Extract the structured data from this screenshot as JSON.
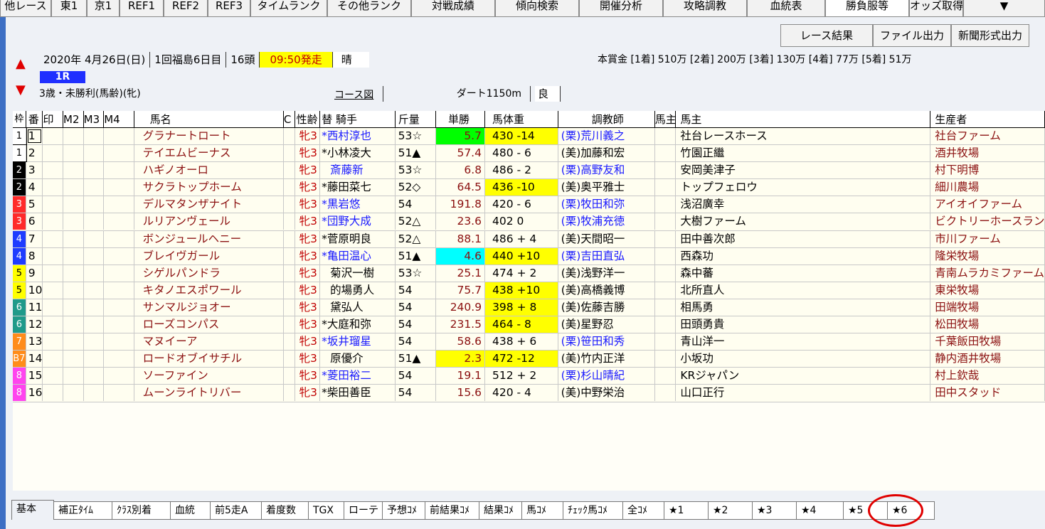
{
  "toolbar": {
    "top": [
      "他レース",
      "東1",
      "京1",
      "REF1",
      "REF2",
      "REF3",
      "タイムランク",
      "その他ランク",
      "対戦成績",
      "傾向検索",
      "開催分析",
      "攻略調教",
      "血統表",
      "勝負服等",
      "オッズ取得"
    ],
    "second": [
      "レース結果",
      "ファイル出力",
      "新聞形式出力"
    ]
  },
  "race": {
    "date": "2020年 4月26日(日)",
    "meeting": "1回福島6日目",
    "runners": "16頭",
    "start_time": "09:50発走",
    "weather": "晴",
    "race_no": "1R",
    "condition": "3歳・未勝利(馬齢)(牝)",
    "course_link": "コース図",
    "course": "ダート1150m",
    "track": "良",
    "prize": "本賞金 [1着] 510万 [2着] 200万 [3着] 130万 [4着] 77万 [5着] 51万"
  },
  "headers": {
    "waku": "枠",
    "ban": "番",
    "in": "印",
    "m2": "M2",
    "m3": "M3",
    "m4": "M4",
    "name": "馬名",
    "c": "C",
    "sex": "性齢",
    "jockey": "替 騎手",
    "kin": "斤量",
    "odds": "単勝",
    "bw": "馬体重",
    "trainer": "調教師",
    "uma": "馬主",
    "owner": "馬主",
    "breeder": "生産者"
  },
  "horses": [
    {
      "waku": "1",
      "ban": "1",
      "name": "グラナートロート",
      "sex": "牝3",
      "jockey": "*西村淳也",
      "kin": "53☆",
      "odds": "5.7",
      "bw": "430 -14",
      "trainer": "(栗)荒川義之",
      "owner": "社台レースホース",
      "breeder": "社台ファーム"
    },
    {
      "waku": "1",
      "ban": "2",
      "name": "テイエムビーナス",
      "sex": "牝3",
      "jockey": "*小林凌大",
      "kin": "51▲",
      "odds": "57.4",
      "bw": "480 - 6",
      "trainer": "(美)加藤和宏",
      "owner": "竹園正繼",
      "breeder": "酒井牧場"
    },
    {
      "waku": "2",
      "ban": "3",
      "name": "ハギノオーロ",
      "sex": "牝3",
      "jockey": "斎藤新",
      "kin": "53☆",
      "odds": "6.8",
      "bw": "486 - 2",
      "trainer": "(栗)高野友和",
      "owner": "安岡美津子",
      "breeder": "村下明博"
    },
    {
      "waku": "2",
      "ban": "4",
      "name": "サクラトップホーム",
      "sex": "牝3",
      "jockey": "*藤田菜七",
      "kin": "52◇",
      "odds": "64.5",
      "bw": "436 -10",
      "trainer": "(美)奥平雅士",
      "owner": "トップフェロウ",
      "breeder": "細川農場"
    },
    {
      "waku": "3",
      "ban": "5",
      "name": "デルマタンザナイト",
      "sex": "牝3",
      "jockey": "*黒岩悠",
      "kin": "54",
      "odds": "191.8",
      "bw": "420 - 6",
      "trainer": "(栗)牧田和弥",
      "owner": "浅沼廣幸",
      "breeder": "アイオイファーム"
    },
    {
      "waku": "3",
      "ban": "6",
      "name": "ルリアンヴェール",
      "sex": "牝3",
      "jockey": "*団野大成",
      "kin": "52△",
      "odds": "23.6",
      "bw": "402   0",
      "trainer": "(栗)牧浦充徳",
      "owner": "大樹ファーム",
      "breeder": "ビクトリーホースランチ"
    },
    {
      "waku": "4",
      "ban": "7",
      "name": "ボンジュールヘニー",
      "sex": "牝3",
      "jockey": "*菅原明良",
      "kin": "52△",
      "odds": "88.1",
      "bw": "486 + 4",
      "trainer": "(美)天間昭一",
      "owner": "田中善次郎",
      "breeder": "市川ファーム"
    },
    {
      "waku": "4",
      "ban": "8",
      "name": "ブレイヴガール",
      "sex": "牝3",
      "jockey": "*亀田温心",
      "kin": "51▲",
      "odds": "4.6",
      "bw": "440 +10",
      "trainer": "(栗)吉田直弘",
      "owner": "西森功",
      "breeder": "隆栄牧場"
    },
    {
      "waku": "5",
      "ban": "9",
      "name": "シゲルパンドラ",
      "sex": "牝3",
      "jockey": "菊沢一樹",
      "kin": "53☆",
      "odds": "25.1",
      "bw": "474 + 2",
      "trainer": "(美)浅野洋一",
      "owner": "森中蕃",
      "breeder": "青南ムラカミファーム"
    },
    {
      "waku": "5",
      "ban": "10",
      "name": "キタノエスポワール",
      "sex": "牝3",
      "jockey": "的場勇人",
      "kin": "54",
      "odds": "75.7",
      "bw": "438 +10",
      "trainer": "(美)高橋義博",
      "owner": "北所直人",
      "breeder": "東栄牧場"
    },
    {
      "waku": "6",
      "ban": "11",
      "name": "サンマルジョオー",
      "sex": "牝3",
      "jockey": "黛弘人",
      "kin": "54",
      "odds": "240.9",
      "bw": "398 + 8",
      "trainer": "(美)佐藤吉勝",
      "owner": "相馬勇",
      "breeder": "田端牧場"
    },
    {
      "waku": "6",
      "ban": "12",
      "name": "ローズコンパス",
      "sex": "牝3",
      "jockey": "*大庭和弥",
      "kin": "54",
      "odds": "231.5",
      "bw": "464 - 8",
      "trainer": "(美)星野忍",
      "owner": "田頭勇貴",
      "breeder": "松田牧場"
    },
    {
      "waku": "7",
      "ban": "13",
      "name": "マヌイーア",
      "sex": "牝3",
      "jockey": "*坂井瑠星",
      "kin": "54",
      "odds": "58.6",
      "bw": "438 + 6",
      "trainer": "(栗)笹田和秀",
      "owner": "青山洋一",
      "breeder": "千葉飯田牧場"
    },
    {
      "waku": "B7",
      "ban": "14",
      "name": "ロードオブイサチル",
      "sex": "牝3",
      "jockey": "原優介",
      "kin": "51▲",
      "odds": "2.3",
      "bw": "472 -12",
      "trainer": "(美)竹内正洋",
      "owner": "小坂功",
      "breeder": "静内酒井牧場"
    },
    {
      "waku": "8",
      "ban": "15",
      "name": "ソーファイン",
      "sex": "牝3",
      "jockey": "*菱田裕二",
      "kin": "54",
      "odds": "19.1",
      "bw": "512 + 2",
      "trainer": "(栗)杉山晴紀",
      "owner": "KRジャパン",
      "breeder": "村上欽哉"
    },
    {
      "waku": "8",
      "ban": "16",
      "name": "ムーンライトリバー",
      "sex": "牝3",
      "jockey": "*柴田善臣",
      "kin": "54",
      "odds": "15.6",
      "bw": "420 - 4",
      "trainer": "(美)中野栄治",
      "owner": "山口正行",
      "breeder": "田中スタッド"
    }
  ],
  "tabs": [
    "基本",
    "補正ﾀｲﾑ",
    "ｸﾗｽ別着",
    "血統",
    "前5走A",
    "着度数",
    "TGX",
    "ローテ",
    "予想ｺﾒ",
    "前結果ｺﾒ",
    "結果ｺﾒ",
    "馬ｺﾒ",
    "ﾁｪｯｸ馬ｺﾒ",
    "全ｺﾒ",
    "★1",
    "★2",
    "★3",
    "★4",
    "★5",
    "★6"
  ],
  "colors": {
    "waku1": "#ffffff",
    "waku2": "#000000",
    "waku3": "#ff2a2a",
    "waku4": "#1e3cff",
    "waku5": "#ffff00",
    "waku6": "#1f9a8a",
    "waku7": "#ff8c1a",
    "waku8": "#ff44ee",
    "odds_fav1": "#00ff00",
    "odds_fav2": "#00ffff",
    "odds_fav3": "#ffff00",
    "bw_highlight": "#ffff00",
    "circle": "#e00000"
  }
}
